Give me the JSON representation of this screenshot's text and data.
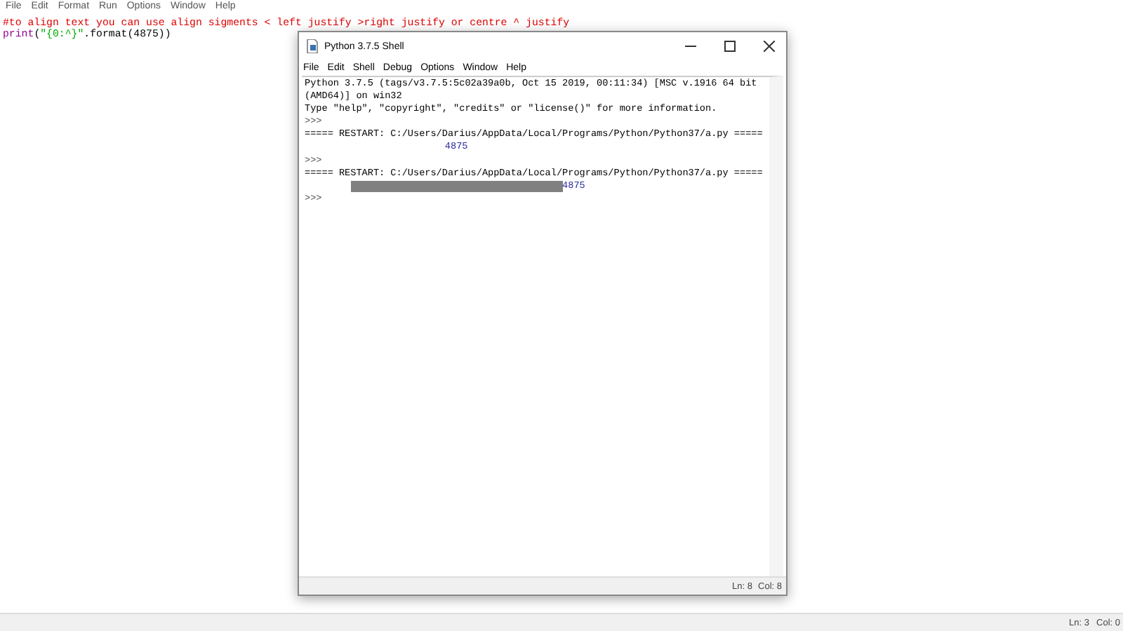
{
  "editor": {
    "menu": [
      "File",
      "Edit",
      "Format",
      "Run",
      "Options",
      "Window",
      "Help"
    ],
    "lines": [
      [
        {
          "text": "#to align text you can use align sigments < left justify >right justify or centre ^ justify",
          "kind": "comment"
        }
      ],
      [
        {
          "text": "print",
          "kind": "builtin"
        },
        {
          "text": "(",
          "kind": "plain"
        },
        {
          "text": "\"{0:^}\"",
          "kind": "string"
        },
        {
          "text": ".format(4875))",
          "kind": "plain"
        }
      ]
    ],
    "status": {
      "line": "Ln: 3",
      "col": "Col: 0"
    }
  },
  "shell": {
    "title": "Python 3.7.5 Shell",
    "menu": [
      "File",
      "Edit",
      "Shell",
      "Debug",
      "Options",
      "Window",
      "Help"
    ],
    "lines": [
      {
        "text": "Python 3.7.5 (tags/v3.7.5:5c02a39a0b, Oct 15 2019, 00:11:34) [MSC v.1916 64 bit",
        "kind": "output"
      },
      {
        "text": "(AMD64)] on win32",
        "kind": "output"
      },
      {
        "text": "Type \"help\", \"copyright\", \"credits\" or \"license()\" for more information.",
        "kind": "output"
      },
      {
        "text": ">>>",
        "kind": "prompt"
      },
      {
        "text": "===== RESTART: C:/Users/Darius/AppData/Local/Programs/Python/Python37/a.py =====",
        "kind": "output"
      },
      {
        "text": "4875",
        "kind": "centered-result"
      },
      {
        "text": ">>>",
        "kind": "prompt"
      },
      {
        "text": "===== RESTART: C:/Users/Darius/AppData/Local/Programs/Python/Python37/a.py =====",
        "kind": "output"
      },
      {
        "text": "4875",
        "kind": "selected-result"
      },
      {
        "text": ">>>",
        "kind": "prompt"
      }
    ],
    "status": {
      "line": "Ln: 8",
      "col": "Col: 8"
    }
  }
}
